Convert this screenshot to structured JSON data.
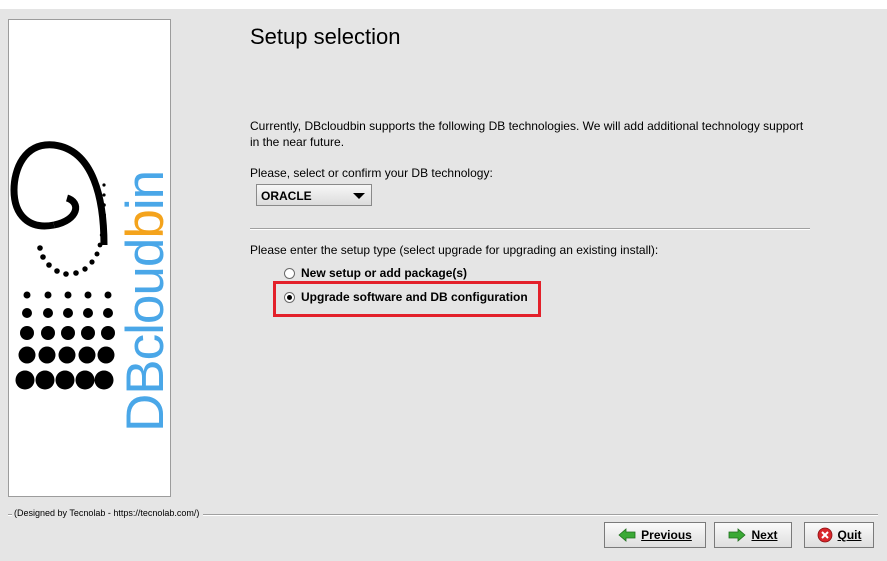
{
  "logo": {
    "text_prefix": "DBcloud",
    "text_highlight": "b",
    "text_suffix": "in"
  },
  "page_title": "Setup selection",
  "info_text": "Currently, DBcloudbin supports the following DB technologies. We will add additional technology support in the near future.",
  "db_label": "Please, select or confirm your DB technology:",
  "db_select": {
    "value": "ORACLE"
  },
  "setup_label": "Please enter the setup type (select upgrade for upgrading an existing install):",
  "options": [
    {
      "label": "New setup or add package(s)",
      "checked": false
    },
    {
      "label": "Upgrade software and DB configuration",
      "checked": true
    }
  ],
  "credit": "(Designed by Tecnolab - https://tecnolab.com/)",
  "buttons": {
    "previous": "Previous",
    "next": "Next",
    "quit": "Quit"
  },
  "colors": {
    "logo_blue": "#4aa7e8",
    "logo_orange": "#f4a31c",
    "highlight": "#e3202a",
    "arrow_green": "#3aa935",
    "quit_red": "#d9262b"
  }
}
